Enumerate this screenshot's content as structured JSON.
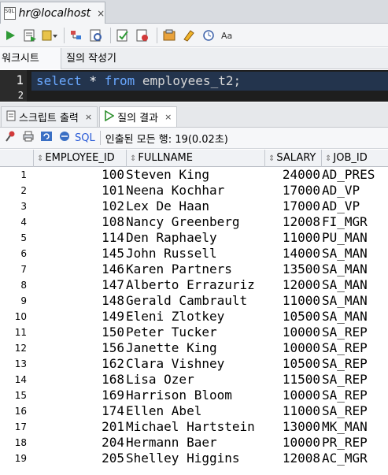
{
  "connection_tab": {
    "icon_text": "SQL",
    "title": "hr@localhost",
    "close": "×"
  },
  "toolbar": {
    "icons": [
      "run-icon",
      "run-script-icon",
      "commit-dropdown-icon",
      "explain-icon",
      "autotrace-icon",
      "commit-icon",
      "rollback-icon",
      "sql-tuning-icon",
      "clear-icon",
      "history-icon",
      "format-icon"
    ]
  },
  "worksheet_tabs": [
    "워크시트",
    "질의 작성기"
  ],
  "editor": {
    "line_numbers": [
      "1",
      "2"
    ],
    "code": {
      "kw1": "select",
      "star": " * ",
      "kw2": "from",
      "table": " employees_t2;"
    }
  },
  "result_tabs": [
    {
      "label": "스크립트 출력",
      "close": "×"
    },
    {
      "label": "질의 결과",
      "close": "×"
    }
  ],
  "result_toolbar": {
    "sql_label": "SQL",
    "status": "인출된 모든 행: 19(0.02초)"
  },
  "grid": {
    "columns": [
      "EMPLOYEE_ID",
      "FULLNAME",
      "SALARY",
      "JOB_ID"
    ],
    "rows": [
      [
        "1",
        "100",
        "Steven King",
        "24000",
        "AD_PRES"
      ],
      [
        "2",
        "101",
        "Neena Kochhar",
        "17000",
        "AD_VP"
      ],
      [
        "3",
        "102",
        "Lex De Haan",
        "17000",
        "AD_VP"
      ],
      [
        "4",
        "108",
        "Nancy Greenberg",
        "12008",
        "FI_MGR"
      ],
      [
        "5",
        "114",
        "Den Raphaely",
        "11000",
        "PU_MAN"
      ],
      [
        "6",
        "145",
        "John Russell",
        "14000",
        "SA_MAN"
      ],
      [
        "7",
        "146",
        "Karen Partners",
        "13500",
        "SA_MAN"
      ],
      [
        "8",
        "147",
        "Alberto Errazuriz",
        "12000",
        "SA_MAN"
      ],
      [
        "9",
        "148",
        "Gerald Cambrault",
        "11000",
        "SA_MAN"
      ],
      [
        "10",
        "149",
        "Eleni Zlotkey",
        "10500",
        "SA_MAN"
      ],
      [
        "11",
        "150",
        "Peter Tucker",
        "10000",
        "SA_REP"
      ],
      [
        "12",
        "156",
        "Janette King",
        "10000",
        "SA_REP"
      ],
      [
        "13",
        "162",
        "Clara Vishney",
        "10500",
        "SA_REP"
      ],
      [
        "14",
        "168",
        "Lisa Ozer",
        "11500",
        "SA_REP"
      ],
      [
        "15",
        "169",
        "Harrison Bloom",
        "10000",
        "SA_REP"
      ],
      [
        "16",
        "174",
        "Ellen Abel",
        "11000",
        "SA_REP"
      ],
      [
        "17",
        "201",
        "Michael Hartstein",
        "13000",
        "MK_MAN"
      ],
      [
        "18",
        "204",
        "Hermann Baer",
        "10000",
        "PR_REP"
      ],
      [
        "19",
        "205",
        "Shelley Higgins",
        "12008",
        "AC_MGR"
      ]
    ]
  }
}
